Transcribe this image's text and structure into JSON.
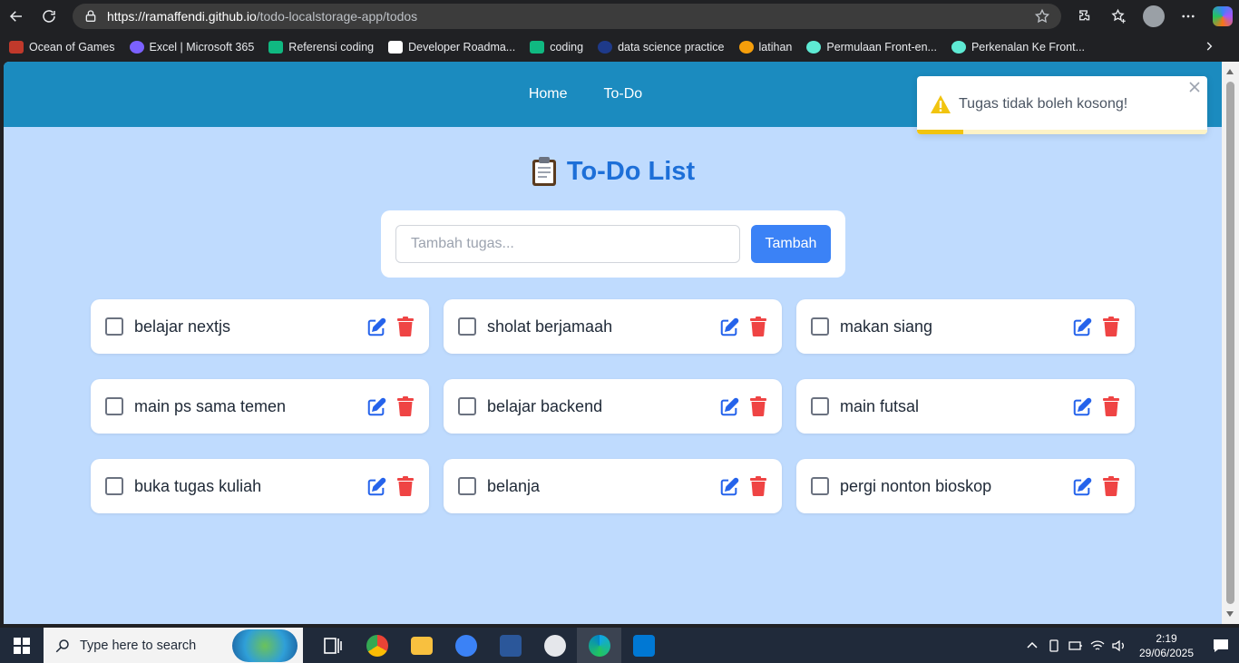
{
  "browser": {
    "url_host": "https://ramaffendi.github.io",
    "url_path": "/todo-localstorage-app/todos",
    "bookmarks": [
      {
        "label": "Ocean of Games",
        "color": "#c0392b"
      },
      {
        "label": "Excel | Microsoft 365",
        "color": "#7b61ff"
      },
      {
        "label": "Referensi coding",
        "color": "#10b981"
      },
      {
        "label": "Developer Roadma...",
        "color": "#ffffff"
      },
      {
        "label": "coding",
        "color": "#10b981"
      },
      {
        "label": "data science practice",
        "color": "#1e3a8a"
      },
      {
        "label": "latihan",
        "color": "#f59e0b"
      },
      {
        "label": "Permulaan Front-en...",
        "color": "#5eead4"
      },
      {
        "label": "Perkenalan Ke Front...",
        "color": "#5eead4"
      }
    ]
  },
  "nav": {
    "home": "Home",
    "todo": "To-Do"
  },
  "page": {
    "title": "To-Do List",
    "input_placeholder": "Tambah tugas...",
    "add_button": "Tambah"
  },
  "todos": [
    {
      "text": "belajar nextjs"
    },
    {
      "text": "sholat berjamaah"
    },
    {
      "text": "makan siang"
    },
    {
      "text": "main ps sama temen"
    },
    {
      "text": "belajar backend"
    },
    {
      "text": "main futsal"
    },
    {
      "text": "buka tugas kuliah"
    },
    {
      "text": "belanja"
    },
    {
      "text": "pergi nonton bioskop"
    }
  ],
  "toast": {
    "message": "Tugas tidak boleh kosong!",
    "progress": 0.16
  },
  "taskbar": {
    "search_placeholder": "Type here to search",
    "time": "2:19",
    "date": "29/06/2025"
  },
  "colors": {
    "navbar": "#1b8bbf",
    "background": "#bfdbfe",
    "title": "#1d6fd8",
    "button": "#3b82f6",
    "edit_icon": "#2563eb",
    "delete_icon": "#ef4444",
    "warning": "#f1c40f"
  }
}
